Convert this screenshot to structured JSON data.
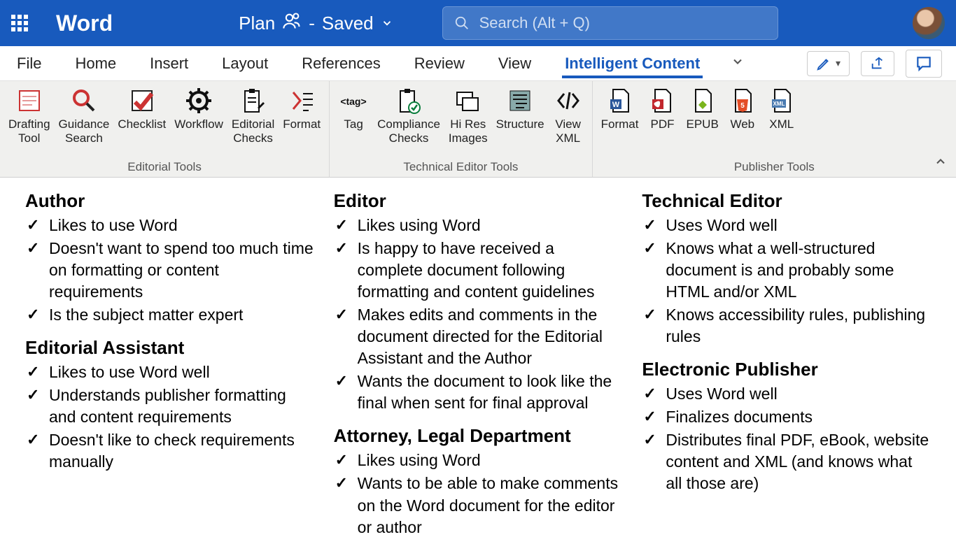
{
  "titlebar": {
    "app_name": "Word",
    "doc_name": "Plan",
    "save_status": "Saved",
    "search_placeholder": "Search (Alt + Q)"
  },
  "tabs": {
    "file": "File",
    "home": "Home",
    "insert": "Insert",
    "layout": "Layout",
    "references": "References",
    "review": "Review",
    "view": "View",
    "intelligent": "Intelligent Content"
  },
  "ribbon": {
    "group1_label": "Editorial Tools",
    "group2_label": "Technical Editor Tools",
    "group3_label": "Publisher Tools",
    "items": {
      "drafting": "Drafting\nTool",
      "guidance": "Guidance\nSearch",
      "checklist": "Checklist",
      "workflow": "Workflow",
      "editorial": "Editorial\nChecks",
      "format": "Format",
      "tag": "Tag",
      "compliance": "Compliance\nChecks",
      "hires": "Hi Res\nImages",
      "structure": "Structure",
      "viewxml": "View\nXML",
      "format2": "Format",
      "pdf": "PDF",
      "epub": "EPUB",
      "web": "Web",
      "xml": "XML"
    }
  },
  "doc": {
    "col1": {
      "s1_title": "Author",
      "s1_items": [
        "Likes to use Word",
        "Doesn't want to spend too much time on formatting or content requirements",
        "Is the subject matter expert"
      ],
      "s2_title": "Editorial Assistant",
      "s2_items": [
        "Likes to use Word well",
        "Understands publisher formatting and content requirements",
        "Doesn't like to check requirements manually"
      ]
    },
    "col2": {
      "s1_title": "Editor",
      "s1_items": [
        "Likes using Word",
        "Is happy to have received a complete document following formatting and content guidelines",
        "Makes edits and comments in the document directed for the Editorial Assistant and the Author",
        "Wants the document to look like the final when sent for final approval"
      ],
      "s2_title": "Attorney, Legal Department",
      "s2_items": [
        "Likes using Word",
        "Wants to be able to make comments on the Word document for the editor or author"
      ]
    },
    "col3": {
      "s1_title": "Technical Editor",
      "s1_items": [
        "Uses Word well",
        "Knows what a well-structured document is and probably some HTML and/or XML",
        "Knows accessibility rules, publishing rules"
      ],
      "s2_title": "Electronic Publisher",
      "s2_items": [
        "Uses Word well",
        "Finalizes documents",
        "Distributes final PDF, eBook, website content and XML (and knows what all those are)"
      ]
    }
  }
}
